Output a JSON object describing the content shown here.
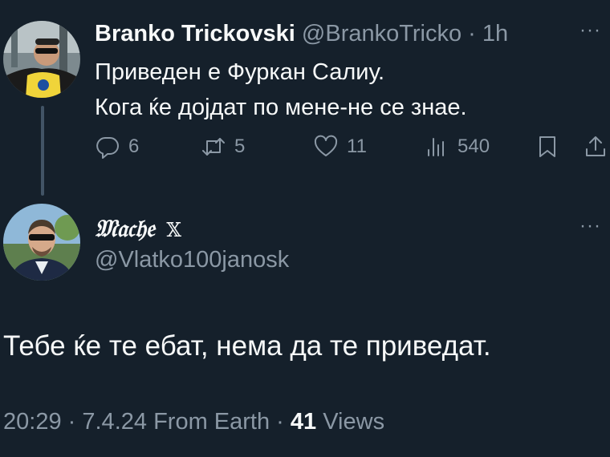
{
  "tweet1": {
    "display_name": "Branko Trickovski",
    "handle": "@BrankoTricko",
    "separator": "·",
    "time": "1h",
    "more_label": "···",
    "lines": [
      "Приведен е Фуркан Салиу.",
      "Кога ќе дојдат по мене-не се знае."
    ],
    "actions": {
      "reply_icon": "reply-icon",
      "reply_count": "6",
      "retweet_icon": "retweet-icon",
      "retweet_count": "5",
      "like_icon": "heart-icon",
      "like_count": "11",
      "views_icon": "views-icon",
      "views_count": "540",
      "bookmark_icon": "bookmark-icon",
      "share_icon": "share-icon"
    }
  },
  "tweet2": {
    "display_name": "𝔐𝔞𝔠𝔥𝔢",
    "x_mark": "𝕏",
    "handle": "@Vlatko100janosk",
    "more_label": "···",
    "text": "Тебе ќе те ебат, нема да те приведат.",
    "meta": {
      "time": "20:29",
      "sep1": "·",
      "date": "7.4.24",
      "source": "From Earth",
      "sep2": "·",
      "views_count": "41",
      "views_label": "Views"
    }
  },
  "colors": {
    "background": "#15202b",
    "text_primary": "#f7f9f9",
    "text_secondary": "#8b98a5",
    "thread_line": "#425466"
  }
}
